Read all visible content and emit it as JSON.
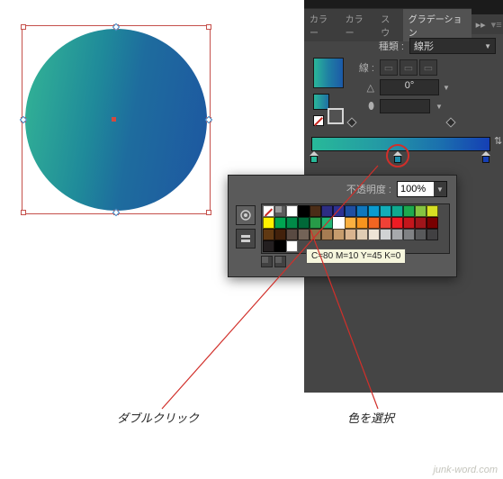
{
  "colors": {
    "accent_red": "#d12f2a",
    "panel_bg": "#525252"
  },
  "canvas": {
    "shape": "circle-object",
    "fill_gradient": [
      "#34b695",
      "#1d56a1"
    ]
  },
  "tabs": {
    "items": [
      {
        "label": "カラー"
      },
      {
        "label": "カラー"
      },
      {
        "label": "スウ"
      },
      {
        "label": "グラデーション"
      }
    ],
    "flyout_glyph": "▸▸",
    "menu_glyph": "▾≡"
  },
  "grad_panel": {
    "type_label": "種類 :",
    "type_value": "線形",
    "stroke_label": "線 :",
    "angle_icon": "△",
    "angle_value": "0°",
    "aspect_icon": "⬮",
    "opacity_stub": "",
    "reverse_icon": "⇅",
    "stops": {
      "start_color": "#28b999",
      "mid_color": "#1b8dab",
      "end_color": "#153fb4"
    }
  },
  "swatch_popover": {
    "opacity_label": "不透明度 :",
    "opacity_value": "100%",
    "tooltip": "C=80 M=10 Y=45 K=0",
    "selected_swatch": "#ffffff",
    "palette_row1": [
      "none",
      "reg",
      "#ffffff",
      "#000000",
      "#4b2d17",
      "#2d2d83",
      "#2e3192",
      "#1f4ea1",
      "#0f77bd",
      "#0b9bd0",
      "#12aeb9",
      "#0faa8f",
      "#1daa4e",
      "#85c441",
      "#d7df23",
      "#fff200"
    ],
    "palette_row2": [
      "#00a651",
      "#008b48",
      "#006838",
      "#279b48",
      "#22b573",
      "#ffffff-sel",
      "#fbb040",
      "#f7941e",
      "#f26522",
      "#ef4136",
      "#ed1c24",
      "#c4161c",
      "#a0151a",
      "#790000",
      "#603913",
      "#42210b"
    ],
    "palette_row3": [
      "#594a42",
      "#736357",
      "#8b6f47",
      "#a67c52",
      "#c69c6d",
      "#d9b48f",
      "#e0cdb4",
      "#eee4d6",
      "#d1d3d4",
      "#a7a9ac",
      "#808285",
      "#58595b",
      "#414042",
      "#231f20",
      "#000000",
      "#ffffff"
    ]
  },
  "callouts": {
    "double_click": "ダブルクリック",
    "pick_color": "色を選択"
  },
  "watermark": "junk-word.com"
}
